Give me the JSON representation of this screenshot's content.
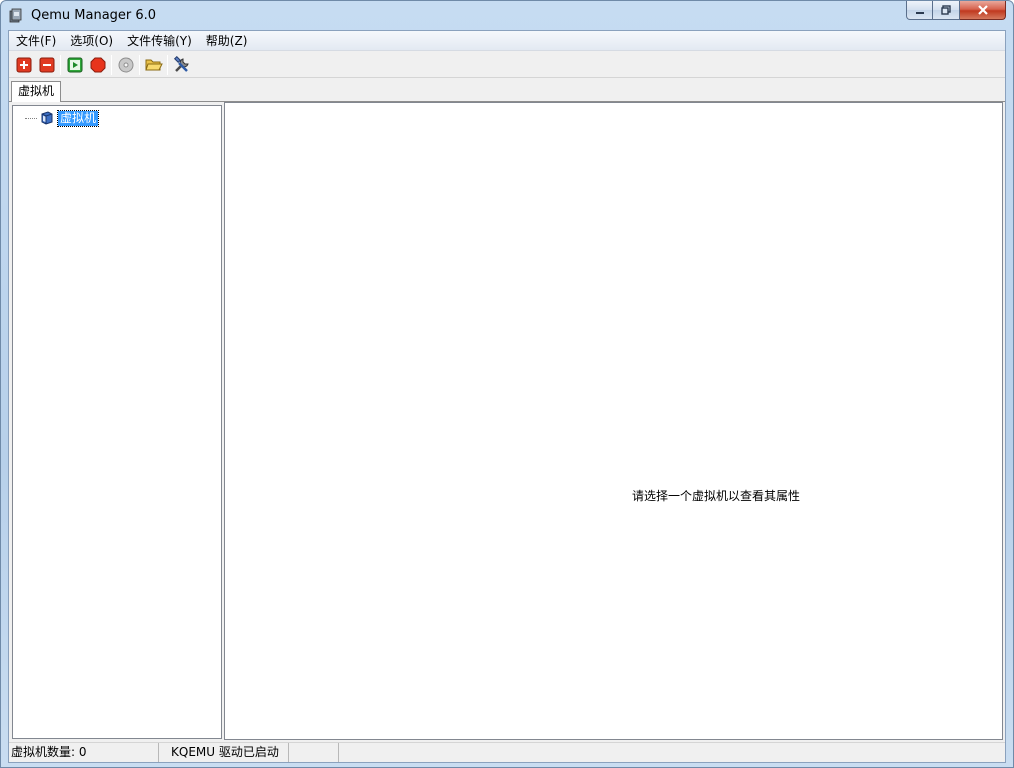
{
  "window": {
    "title": "Qemu Manager 6.0"
  },
  "menu": {
    "items": [
      "文件(F)",
      "选项(O)",
      "文件传输(Y)",
      "帮助(Z)"
    ]
  },
  "toolbar": {
    "buttons": [
      "add-vm-icon",
      "remove-vm-icon",
      "start-icon",
      "stop-icon",
      "disc-icon",
      "open-folder-icon",
      "tools-icon"
    ]
  },
  "tabs": {
    "active": "虚拟机"
  },
  "tree": {
    "root_label": "虚拟机"
  },
  "details": {
    "message": "请选择一个虚拟机以查看其属性"
  },
  "status": {
    "vm_count": "虚拟机数量: 0",
    "kqemu": "KQEMU 驱动已启动",
    "empty": ""
  },
  "colors": {
    "selection": "#3399ff",
    "close_button": "#c0391f",
    "window_frame": "#b7d0ea"
  }
}
